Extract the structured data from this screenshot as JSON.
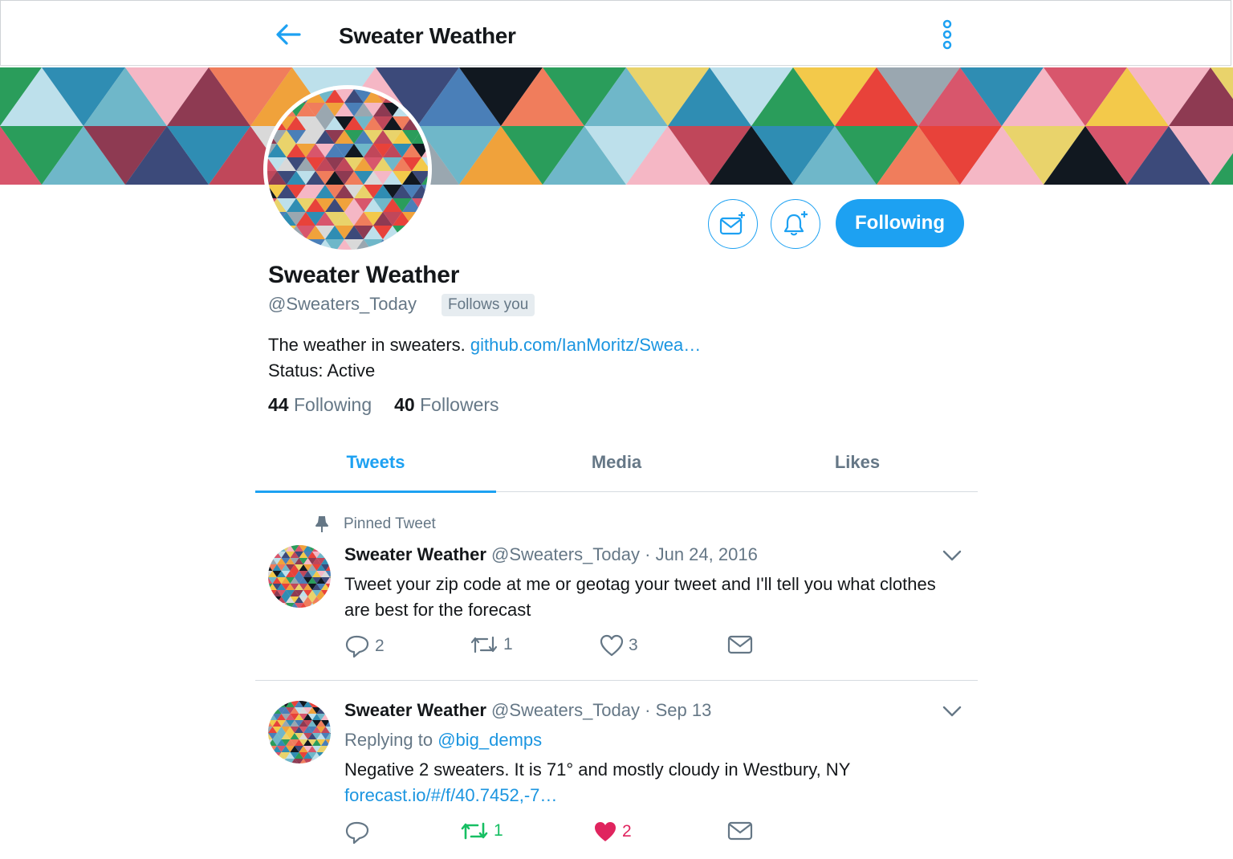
{
  "header": {
    "title": "Sweater Weather",
    "back_icon": "arrow-left-icon",
    "more_icon": "vertical-dots-icon"
  },
  "profile": {
    "name": "Sweater Weather",
    "handle": "@Sweaters_Today",
    "follows_you": "Follows you",
    "bio_text": "The weather in sweaters.",
    "bio_link": "github.com/IanMoritz/Swea…",
    "status": "Status: Active",
    "following_count": "44",
    "following_label": "Following",
    "followers_count": "40",
    "followers_label": "Followers",
    "following_button": "Following"
  },
  "tabs": [
    {
      "label": "Tweets",
      "active": true
    },
    {
      "label": "Media",
      "active": false
    },
    {
      "label": "Likes",
      "active": false
    }
  ],
  "tweets": [
    {
      "pinned_label": "Pinned Tweet",
      "name": "Sweater Weather",
      "handle": "@Sweaters_Today",
      "sep": "·",
      "date": "Jun 24, 2016",
      "text": "Tweet your zip code at me or geotag your tweet and I'll tell you what clothes are best for the forecast",
      "replies": "2",
      "retweets": "1",
      "likes": "3"
    },
    {
      "name": "Sweater Weather",
      "handle": "@Sweaters_Today",
      "sep": "·",
      "date": "Sep 13",
      "replying_prefix": "Replying to",
      "replying_to": "@big_demps",
      "text": "Negative 2 sweaters. It is 71° and mostly cloudy in Westbury, NY",
      "link": "forecast.io/#/f/40.7452,-7…",
      "replies": "",
      "retweets": "1",
      "likes": "2",
      "retweeted": true,
      "liked": true
    }
  ],
  "colors": {
    "accent": "#1da1f2",
    "link": "#1b95e0",
    "muted": "#657786",
    "retweet_green": "#17bf63",
    "like_red": "#e0245e"
  }
}
